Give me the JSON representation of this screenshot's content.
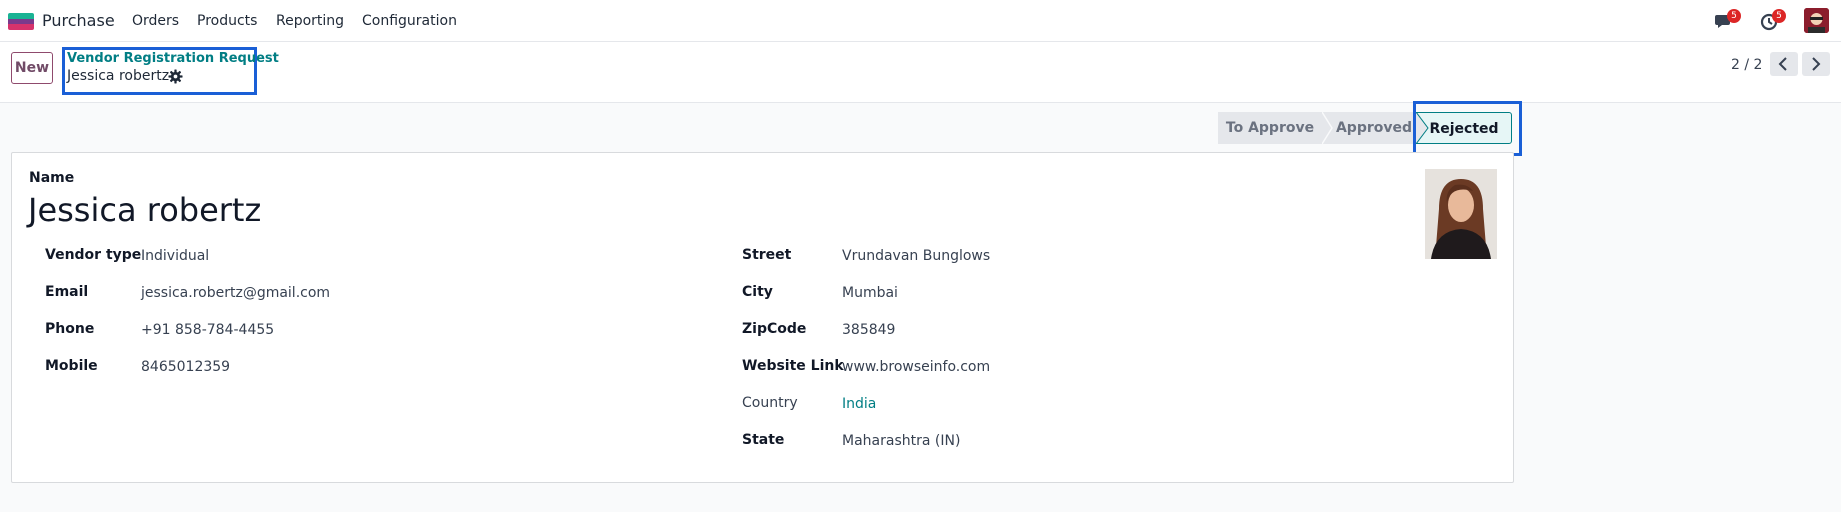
{
  "navbar": {
    "app_name": "Purchase",
    "menu": [
      "Orders",
      "Products",
      "Reporting",
      "Configuration"
    ],
    "messages_count": "5",
    "activities_count": "5"
  },
  "control_panel": {
    "new_label": "New",
    "breadcrumb_parent": "Vendor Registration Request",
    "breadcrumb_current": "Jessica robertz",
    "pager": "2 / 2"
  },
  "statusbar": {
    "stages": [
      "To Approve",
      "Approved",
      "Rejected"
    ],
    "active": "Rejected"
  },
  "form": {
    "name_label": "Name",
    "name_value": "Jessica robertz",
    "left_fields": [
      {
        "label": "Vendor type",
        "value": "Individual"
      },
      {
        "label": "Email",
        "value": "jessica.robertz@gmail.com"
      },
      {
        "label": "Phone",
        "value": "+91 858-784-4455"
      },
      {
        "label": "Mobile",
        "value": "8465012359"
      }
    ],
    "right_fields": [
      {
        "label": "Street",
        "value": "Vrundavan Bunglows"
      },
      {
        "label": "City",
        "value": "Mumbai"
      },
      {
        "label": "ZipCode",
        "value": "385849"
      },
      {
        "label": "Website Link",
        "value": "www.browseinfo.com"
      },
      {
        "label": "Country",
        "value": "India"
      },
      {
        "label": "State",
        "value": "Maharashtra (IN)"
      }
    ]
  },
  "colors": {
    "brand": "#714b67",
    "link": "#017e84",
    "highlight_box": "#1a5fd6",
    "badge": "#dc2626"
  }
}
